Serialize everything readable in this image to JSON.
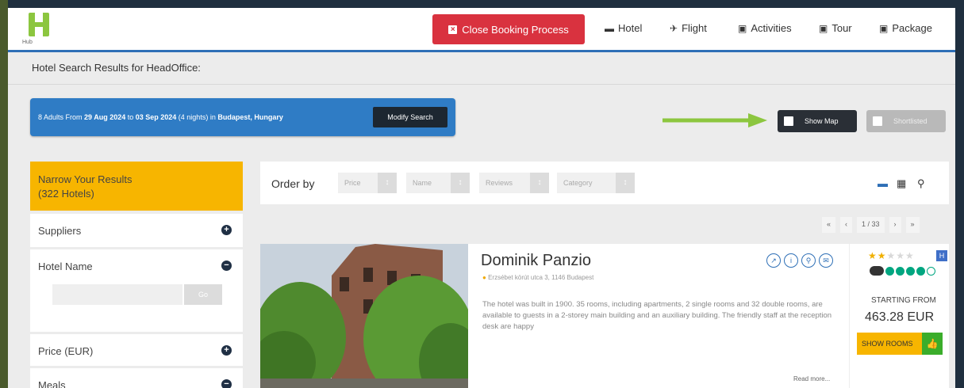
{
  "header": {
    "logo_text": "Hub",
    "close_booking": "Close Booking Process",
    "nav": [
      {
        "label": "Hotel",
        "icon": "bed-icon"
      },
      {
        "label": "Flight",
        "icon": "plane-icon"
      },
      {
        "label": "Activities",
        "icon": "ticket-icon"
      },
      {
        "label": "Tour",
        "icon": "ticket-icon"
      },
      {
        "label": "Package",
        "icon": "ticket-icon"
      }
    ]
  },
  "page_title": "Hotel Search Results for HeadOffice:",
  "search": {
    "summary_prefix": "8 Adults From ",
    "date_from": "29 Aug 2024",
    "to_word": " to ",
    "date_to": "03 Sep 2024",
    "nights": " (4 nights) in ",
    "location": "Budapest, Hungary",
    "modify": "Modify Search"
  },
  "toggles": {
    "show_map": "Show Map",
    "shortlisted": "Shortlisted"
  },
  "sidebar": {
    "narrow_title": "Narrow Your Results",
    "narrow_count": "(322 Hotels)",
    "suppliers": "Suppliers",
    "hotel_name": "Hotel Name",
    "hotel_name_go": "Go",
    "price": "Price (EUR)",
    "meals": "Meals"
  },
  "order": {
    "label": "Order by",
    "options": [
      "Price",
      "Name",
      "Reviews",
      "Category"
    ]
  },
  "pager": {
    "page": "1 / 33"
  },
  "hotel": {
    "name": "Dominik Panzio",
    "address": "Erzsébet körút utca 3, 1146 Budapest",
    "description": "The hotel was built in 1900. 35 rooms, including apartments, 2 single rooms and 32 double rooms, are available to guests in a 2-storey main building and an auxiliary building. The friendly staff at the reception desk are happy",
    "read_more": "Read more...",
    "stars": 2,
    "starting_from": "STARTING FROM",
    "price": "463.28 EUR",
    "show_rooms": "SHOW ROOMS"
  },
  "colors": {
    "accent_blue": "#2e6fb6",
    "danger": "#d9323f",
    "yellow": "#f7b500",
    "arrow_green": "#8cc63f"
  }
}
